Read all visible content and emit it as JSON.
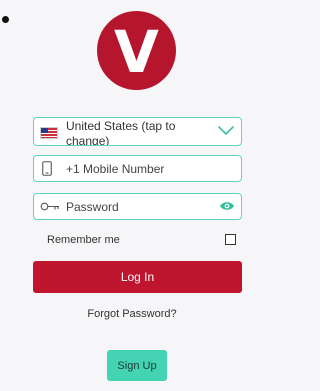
{
  "logo": {
    "letter": "V",
    "color": "#b5152d"
  },
  "country_select": {
    "value": "United States (tap to change)",
    "flag_icon": "us-flag-icon",
    "chevron_icon": "chevron-down-icon"
  },
  "mobile_field": {
    "placeholder": "+1 Mobile Number",
    "icon": "phone-icon"
  },
  "password_field": {
    "placeholder": "Password",
    "icon": "key-icon",
    "toggle_icon": "eye-icon"
  },
  "remember_me": {
    "label": "Remember me",
    "checked": false
  },
  "login_button": {
    "label": "Log In",
    "color": "#c0152f"
  },
  "forgot_password": {
    "label": "Forgot Password?"
  },
  "signup_button": {
    "label": "Sign Up",
    "color": "#44d3b3"
  },
  "colors": {
    "field_border": "#5fd3be",
    "background": "#f6f6f8"
  }
}
